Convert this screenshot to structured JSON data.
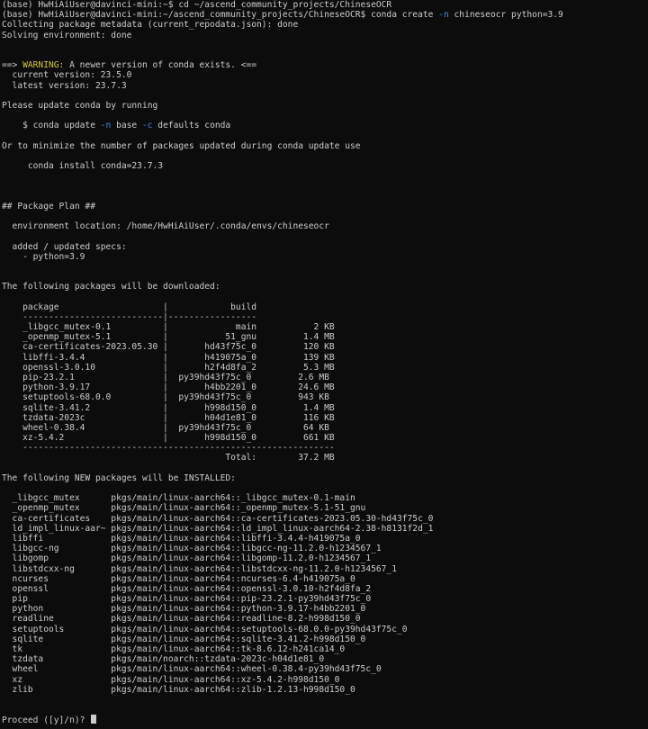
{
  "terminal": {
    "theme": {
      "background": "#0c0c0c",
      "foreground": "#cccccc",
      "warning_color": "#d7c63a",
      "flag_color": "#3b8eea"
    },
    "lines": [
      {
        "kind": "text",
        "text": "(base) HwHiAiUser@davinci-mini:~$ cd ~/ascend_community_projects/ChineseOCR"
      },
      {
        "kind": "cmd_flag",
        "before": "(base) HwHiAiUser@davinci-mini:~/ascend_community_projects/ChineseOCR$ conda create ",
        "flag": "-n",
        "after": " chineseocr python=3.9"
      },
      {
        "kind": "text",
        "text": "Collecting package metadata (current_repodata.json): done"
      },
      {
        "kind": "text",
        "text": "Solving environment: done"
      },
      {
        "kind": "blank"
      },
      {
        "kind": "blank"
      },
      {
        "kind": "warning",
        "prefix": "==> ",
        "warn": "WARNING:",
        "suffix": " A newer version of conda exists. <=="
      },
      {
        "kind": "text",
        "text": "  current version: 23.5.0"
      },
      {
        "kind": "text",
        "text": "  latest version: 23.7.3"
      },
      {
        "kind": "blank"
      },
      {
        "kind": "text",
        "text": "Please update conda by running"
      },
      {
        "kind": "blank"
      },
      {
        "kind": "cmd_two_flags",
        "before": "    $ conda update ",
        "flag1": "-n",
        "mid": " base ",
        "flag2": "-c",
        "after": " defaults conda"
      },
      {
        "kind": "blank"
      },
      {
        "kind": "text",
        "text": "Or to minimize the number of packages updated during conda update use"
      },
      {
        "kind": "blank"
      },
      {
        "kind": "text",
        "text": "     conda install conda=23.7.3"
      },
      {
        "kind": "blank"
      },
      {
        "kind": "blank"
      },
      {
        "kind": "blank"
      },
      {
        "kind": "text",
        "text": "## Package Plan ##"
      },
      {
        "kind": "blank"
      },
      {
        "kind": "text",
        "text": "  environment location: /home/HwHiAiUser/.conda/envs/chineseocr"
      },
      {
        "kind": "blank"
      },
      {
        "kind": "text",
        "text": "  added / updated specs:"
      },
      {
        "kind": "text",
        "text": "    - python=3.9"
      },
      {
        "kind": "blank"
      },
      {
        "kind": "blank"
      },
      {
        "kind": "text",
        "text": "The following packages will be downloaded:"
      },
      {
        "kind": "blank"
      },
      {
        "kind": "text",
        "text": "    package                    |            build"
      },
      {
        "kind": "text",
        "text": "    ---------------------------|-----------------"
      },
      {
        "kind": "text",
        "text": "    _libgcc_mutex-0.1          |             main           2 KB"
      },
      {
        "kind": "text",
        "text": "    _openmp_mutex-5.1          |           51_gnu         1.4 MB"
      },
      {
        "kind": "text",
        "text": "    ca-certificates-2023.05.30 |       hd43f75c_0         120 KB"
      },
      {
        "kind": "text",
        "text": "    libffi-3.4.4               |       h419075a_0         139 KB"
      },
      {
        "kind": "text",
        "text": "    openssl-3.0.10             |       h2f4d8fa_2         5.3 MB"
      },
      {
        "kind": "text",
        "text": "    pip-23.2.1                 |  py39hd43f75c_0         2.6 MB"
      },
      {
        "kind": "text",
        "text": "    python-3.9.17              |       h4bb2201_0        24.6 MB"
      },
      {
        "kind": "text",
        "text": "    setuptools-68.0.0          |  py39hd43f75c_0         943 KB"
      },
      {
        "kind": "text",
        "text": "    sqlite-3.41.2              |       h998d150_0         1.4 MB"
      },
      {
        "kind": "text",
        "text": "    tzdata-2023c               |       h04d1e81_0         116 KB"
      },
      {
        "kind": "text",
        "text": "    wheel-0.38.4               |  py39hd43f75c_0          64 KB"
      },
      {
        "kind": "text",
        "text": "    xz-5.4.2                   |       h998d150_0         661 KB"
      },
      {
        "kind": "text",
        "text": "    ------------------------------------------------------------"
      },
      {
        "kind": "text",
        "text": "                                           Total:        37.2 MB"
      },
      {
        "kind": "blank"
      },
      {
        "kind": "text",
        "text": "The following NEW packages will be INSTALLED:"
      },
      {
        "kind": "blank"
      },
      {
        "kind": "text",
        "text": "  _libgcc_mutex      pkgs/main/linux-aarch64::_libgcc_mutex-0.1-main"
      },
      {
        "kind": "text",
        "text": "  _openmp_mutex      pkgs/main/linux-aarch64::_openmp_mutex-5.1-51_gnu"
      },
      {
        "kind": "text",
        "text": "  ca-certificates    pkgs/main/linux-aarch64::ca-certificates-2023.05.30-hd43f75c_0"
      },
      {
        "kind": "text",
        "text": "  ld_impl_linux-aar~ pkgs/main/linux-aarch64::ld_impl_linux-aarch64-2.38-h8131f2d_1"
      },
      {
        "kind": "text",
        "text": "  libffi             pkgs/main/linux-aarch64::libffi-3.4.4-h419075a_0"
      },
      {
        "kind": "text",
        "text": "  libgcc-ng          pkgs/main/linux-aarch64::libgcc-ng-11.2.0-h1234567_1"
      },
      {
        "kind": "text",
        "text": "  libgomp            pkgs/main/linux-aarch64::libgomp-11.2.0-h1234567_1"
      },
      {
        "kind": "text",
        "text": "  libstdcxx-ng       pkgs/main/linux-aarch64::libstdcxx-ng-11.2.0-h1234567_1"
      },
      {
        "kind": "text",
        "text": "  ncurses            pkgs/main/linux-aarch64::ncurses-6.4-h419075a_0"
      },
      {
        "kind": "text",
        "text": "  openssl            pkgs/main/linux-aarch64::openssl-3.0.10-h2f4d8fa_2"
      },
      {
        "kind": "text",
        "text": "  pip                pkgs/main/linux-aarch64::pip-23.2.1-py39hd43f75c_0"
      },
      {
        "kind": "text",
        "text": "  python             pkgs/main/linux-aarch64::python-3.9.17-h4bb2201_0"
      },
      {
        "kind": "text",
        "text": "  readline           pkgs/main/linux-aarch64::readline-8.2-h998d150_0"
      },
      {
        "kind": "text",
        "text": "  setuptools         pkgs/main/linux-aarch64::setuptools-68.0.0-py39hd43f75c_0"
      },
      {
        "kind": "text",
        "text": "  sqlite             pkgs/main/linux-aarch64::sqlite-3.41.2-h998d150_0"
      },
      {
        "kind": "text",
        "text": "  tk                 pkgs/main/linux-aarch64::tk-8.6.12-h241ca14_0"
      },
      {
        "kind": "text",
        "text": "  tzdata             pkgs/main/noarch::tzdata-2023c-h04d1e81_0"
      },
      {
        "kind": "text",
        "text": "  wheel              pkgs/main/linux-aarch64::wheel-0.38.4-py39hd43f75c_0"
      },
      {
        "kind": "text",
        "text": "  xz                 pkgs/main/linux-aarch64::xz-5.4.2-h998d150_0"
      },
      {
        "kind": "text",
        "text": "  zlib               pkgs/main/linux-aarch64::zlib-1.2.13-h998d150_0"
      },
      {
        "kind": "blank"
      },
      {
        "kind": "blank"
      },
      {
        "kind": "prompt",
        "text": "Proceed ([y]/n)? "
      }
    ]
  }
}
